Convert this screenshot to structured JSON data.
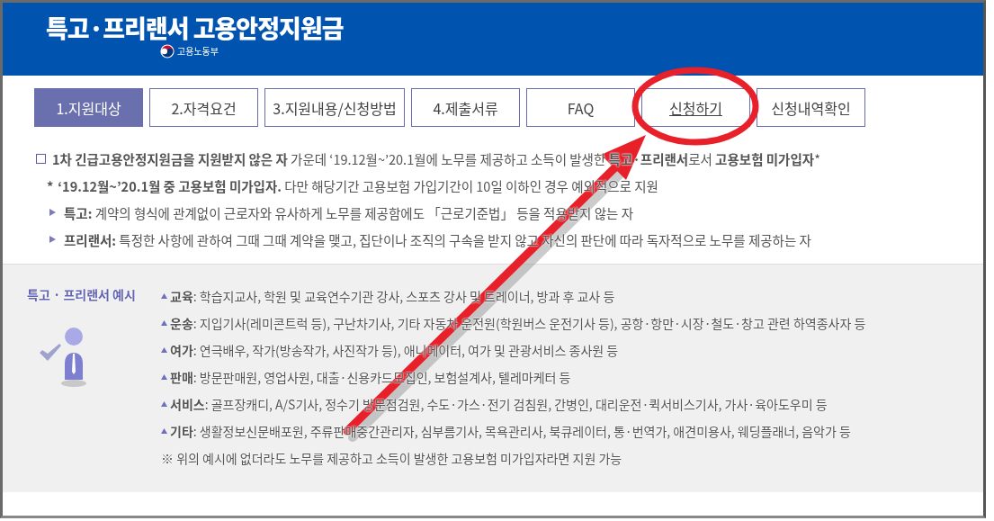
{
  "header": {
    "title": "특고·프리랜서 고용안정지원금",
    "ministry": "고용노동부"
  },
  "tabs": [
    {
      "label": "1.지원대상",
      "selected": true,
      "hovered": false
    },
    {
      "label": "2.자격요건",
      "selected": false,
      "hovered": false
    },
    {
      "label": "3.지원내용/신청방법",
      "selected": false,
      "hovered": false
    },
    {
      "label": "4.제출서류",
      "selected": false,
      "hovered": false
    },
    {
      "label": "FAQ",
      "selected": false,
      "hovered": false
    },
    {
      "label": "신청하기",
      "selected": false,
      "hovered": true
    },
    {
      "label": "신청내역확인",
      "selected": false,
      "hovered": false
    }
  ],
  "intro": [
    {
      "kind": "box",
      "text": "**1차 긴급고용안정지원금을 지원받지 않은 자** 가운데 ‘19.12월~’20.1월에 노무를 제공하고 소득이 발생한 **특고·프리랜서**로서 **고용보험 미가입자***"
    },
    {
      "kind": "note",
      "marker": "*",
      "text": "**‘19.12월~’20.1월 중 고용보험 미가입자.** 다만 해당기간 고용보험 가입기간이 10일 이하인 경우 예외적으로 지원"
    },
    {
      "kind": "arrow",
      "text": "**특고:** 계약의 형식에 관계없이 근로자와 유사하게 노무를 제공함에도 「근로기준법」 등을 적용받지 않는 자"
    },
    {
      "kind": "arrow",
      "text": "**프리랜서:** 특정한 사항에 관하여 그때 그때 계약을 맺고, 집단이나 조직의 구속을 받지 않고 자신의 판단에 따라 독자적으로 노무를 제공하는 자"
    }
  ],
  "examples": {
    "label": "특고 · 프리랜서 예시",
    "items": [
      {
        "kind": "category",
        "text": "**교육**: 학습지교사, 학원 및 교육연수기관 강사, 스포츠 강사 및 트레이너, 방과 후 교사 등"
      },
      {
        "kind": "category",
        "text": "**운송**: 지입기사(레미콘트럭 등), 구난차기사, 기타 자동차 운전원(학원버스 운전기사 등), 공항·항만·시장·철도·창고 관련 하역종사자 등"
      },
      {
        "kind": "category",
        "text": "**여가**: 연극배우, 작가(방송작가, 사진작가 등), 애니메이터, 여가 및 관광서비스 종사원 등"
      },
      {
        "kind": "category",
        "text": "**판매**: 방문판매원, 영업사원, 대출·신용카드모집인, 보험설계사, 텔레마케터 등"
      },
      {
        "kind": "category",
        "text": "**서비스**: 골프장캐디, A/S기사, 정수기 방문점검원, 수도·가스·전기 검침원, 간병인, 대리운전·퀵서비스기사, 가사·육아도우미 등"
      },
      {
        "kind": "category",
        "text": "**기타**: 생활정보신문배포원, 주류판매중간관리자, 심부름기사, 목욕관리사, 북큐레이터, 통·번역가, 애견미용사, 웨딩플래너, 음악가 등"
      },
      {
        "kind": "remark",
        "text": "※ 위의 예시에 없더라도 노무를 제공하고 소득이 발생한 고용보험 미가입자라면 지원 가능"
      }
    ]
  }
}
